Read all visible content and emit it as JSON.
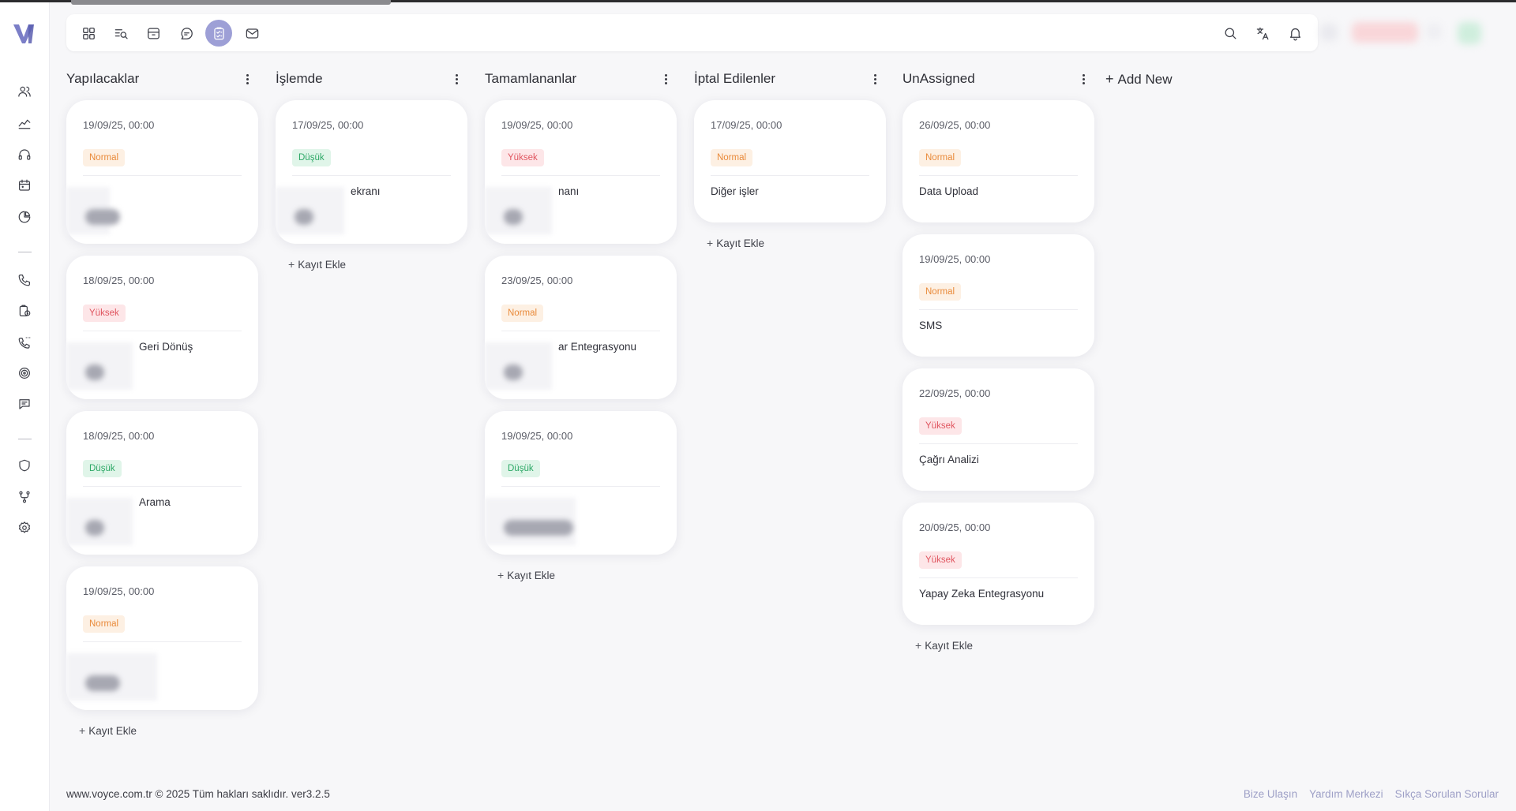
{
  "app": {
    "name": "Voyce"
  },
  "topbar": {
    "left_icons": [
      "dashboard-icon",
      "list-search-icon",
      "archive-icon",
      "chat-bubble-icon",
      "task-board-icon",
      "mail-icon"
    ],
    "active_icon": "task-board-icon",
    "right_icons": [
      "search-icon",
      "translate-icon",
      "bell-icon"
    ]
  },
  "sidebar": {
    "icons": [
      "users-icon",
      "analytics-icon",
      "headset-icon",
      "calendar-icon",
      "pie-chart-icon",
      "phone-icon",
      "clipboard-clock-icon",
      "phone-dots-icon",
      "target-icon",
      "message-icon",
      "shield-icon",
      "flow-icon",
      "settings-icon"
    ]
  },
  "board": {
    "add_new_label": "Add New",
    "add_record_label": "Kayıt Ekle",
    "columns": [
      {
        "title": "Yapılacaklar",
        "cards": [
          {
            "date": "19/09/25, 00:00",
            "priority": "Normal",
            "title": ""
          },
          {
            "date": "18/09/25, 00:00",
            "priority": "Yüksek",
            "title": "Geri Dönüş"
          },
          {
            "date": "18/09/25, 00:00",
            "priority": "Düşük",
            "title": "Arama"
          },
          {
            "date": "19/09/25, 00:00",
            "priority": "Normal",
            "title": ""
          }
        ]
      },
      {
        "title": "İşlemde",
        "cards": [
          {
            "date": "17/09/25, 00:00",
            "priority": "Düşük",
            "title": "ekranı"
          }
        ]
      },
      {
        "title": "Tamamlananlar",
        "cards": [
          {
            "date": "19/09/25, 00:00",
            "priority": "Yüksek",
            "title": "nanı"
          },
          {
            "date": "23/09/25, 00:00",
            "priority": "Normal",
            "title": "ar Entegrasyonu"
          },
          {
            "date": "19/09/25, 00:00",
            "priority": "Düşük",
            "title": ""
          }
        ]
      },
      {
        "title": "İptal Edilenler",
        "cards": [
          {
            "date": "17/09/25, 00:00",
            "priority": "Normal",
            "title": "Diğer işler"
          }
        ]
      },
      {
        "title": "UnAssigned",
        "cards": [
          {
            "date": "26/09/25, 00:00",
            "priority": "Normal",
            "title": "Data Upload"
          },
          {
            "date": "19/09/25, 00:00",
            "priority": "Normal",
            "title": "SMS"
          },
          {
            "date": "22/09/25, 00:00",
            "priority": "Yüksek",
            "title": "Çağrı Analizi"
          },
          {
            "date": "20/09/25, 00:00",
            "priority": "Yüksek",
            "title": "Yapay Zeka Entegrasyonu"
          }
        ]
      }
    ]
  },
  "footer": {
    "copyright": "www.voyce.com.tr © 2025 Tüm hakları saklıdır. ver3.2.5",
    "links": [
      "Bize Ulaşın",
      "Yardım Merkezi",
      "Sıkça Sorulan Sorular"
    ]
  },
  "colors": {
    "accent": "#9d9fd6",
    "normal_badge": "#e98a3a",
    "yuksek_badge": "#e0555f",
    "dusuk_badge": "#2da866",
    "footer_link": "#9d9fc6"
  }
}
